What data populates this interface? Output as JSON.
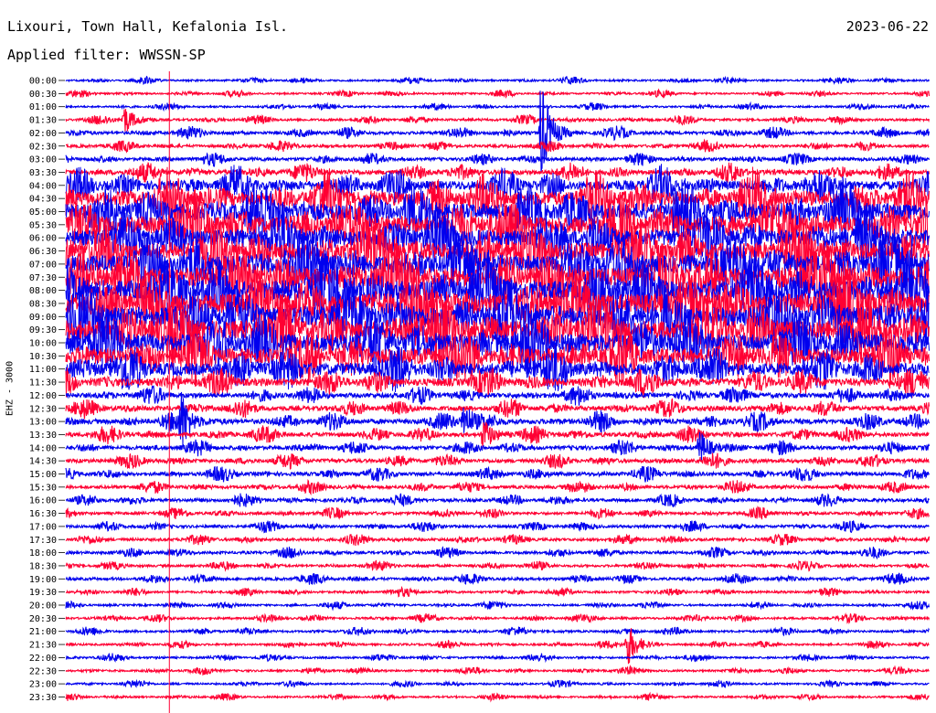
{
  "header": {
    "station": "Lixouri, Town Hall, Kefalonia Isl.",
    "date": "2023-06-22",
    "filter": "Applied filter: WWSSN-SP",
    "channel": "EHZ - 3000"
  },
  "colors": {
    "trace_a": "#0000ee",
    "trace_b": "#ff0033",
    "marker": "#ff0033",
    "background": "#ffffff",
    "text": "#000000"
  },
  "chart_data": {
    "type": "line",
    "title": "Lixouri, Town Hall, Kefalonia Isl.",
    "ylabel": "EHZ - 3000",
    "xlabel": "",
    "row_labels": [
      "00:00",
      "00:30",
      "01:00",
      "01:30",
      "02:00",
      "02:30",
      "03:00",
      "03:30",
      "04:00",
      "04:30",
      "05:00",
      "05:30",
      "06:00",
      "06:30",
      "07:00",
      "07:30",
      "08:00",
      "08:30",
      "09:00",
      "09:30",
      "10:00",
      "10:30",
      "11:00",
      "11:30",
      "12:00",
      "12:30",
      "13:00",
      "13:30",
      "14:00",
      "14:30",
      "15:00",
      "15:30",
      "16:00",
      "16:30",
      "17:00",
      "17:30",
      "18:00",
      "18:30",
      "19:00",
      "19:30",
      "20:00",
      "20:30",
      "21:00",
      "21:30",
      "22:00",
      "22:30",
      "23:00",
      "23:30"
    ],
    "row_minutes": 30,
    "row_colors": [
      "trace_a",
      "trace_b"
    ],
    "activity_level": [
      0.05,
      0.05,
      0.05,
      0.08,
      0.12,
      0.1,
      0.12,
      0.2,
      0.45,
      0.7,
      0.8,
      0.85,
      0.8,
      0.85,
      0.9,
      0.95,
      1.0,
      1.0,
      1.0,
      0.95,
      0.9,
      0.75,
      0.6,
      0.35,
      0.2,
      0.2,
      0.22,
      0.18,
      0.15,
      0.15,
      0.15,
      0.12,
      0.12,
      0.1,
      0.1,
      0.1,
      0.1,
      0.08,
      0.1,
      0.07,
      0.06,
      0.07,
      0.07,
      0.06,
      0.06,
      0.06,
      0.05,
      0.05
    ],
    "events": [
      {
        "row": 4,
        "minute": 16.5,
        "amplitude": 1.0
      },
      {
        "row": 3,
        "minute": 2.0,
        "amplitude": 0.3
      },
      {
        "row": 26,
        "minute": 4.0,
        "amplitude": 0.45
      },
      {
        "row": 26,
        "minute": 13.8,
        "amplitude": 0.4
      },
      {
        "row": 27,
        "minute": 14.5,
        "amplitude": 0.3
      },
      {
        "row": 28,
        "minute": 22.0,
        "amplitude": 0.35
      },
      {
        "row": 43,
        "minute": 19.5,
        "amplitude": 0.45
      }
    ],
    "marker_minute": 3.6,
    "grid": false
  }
}
